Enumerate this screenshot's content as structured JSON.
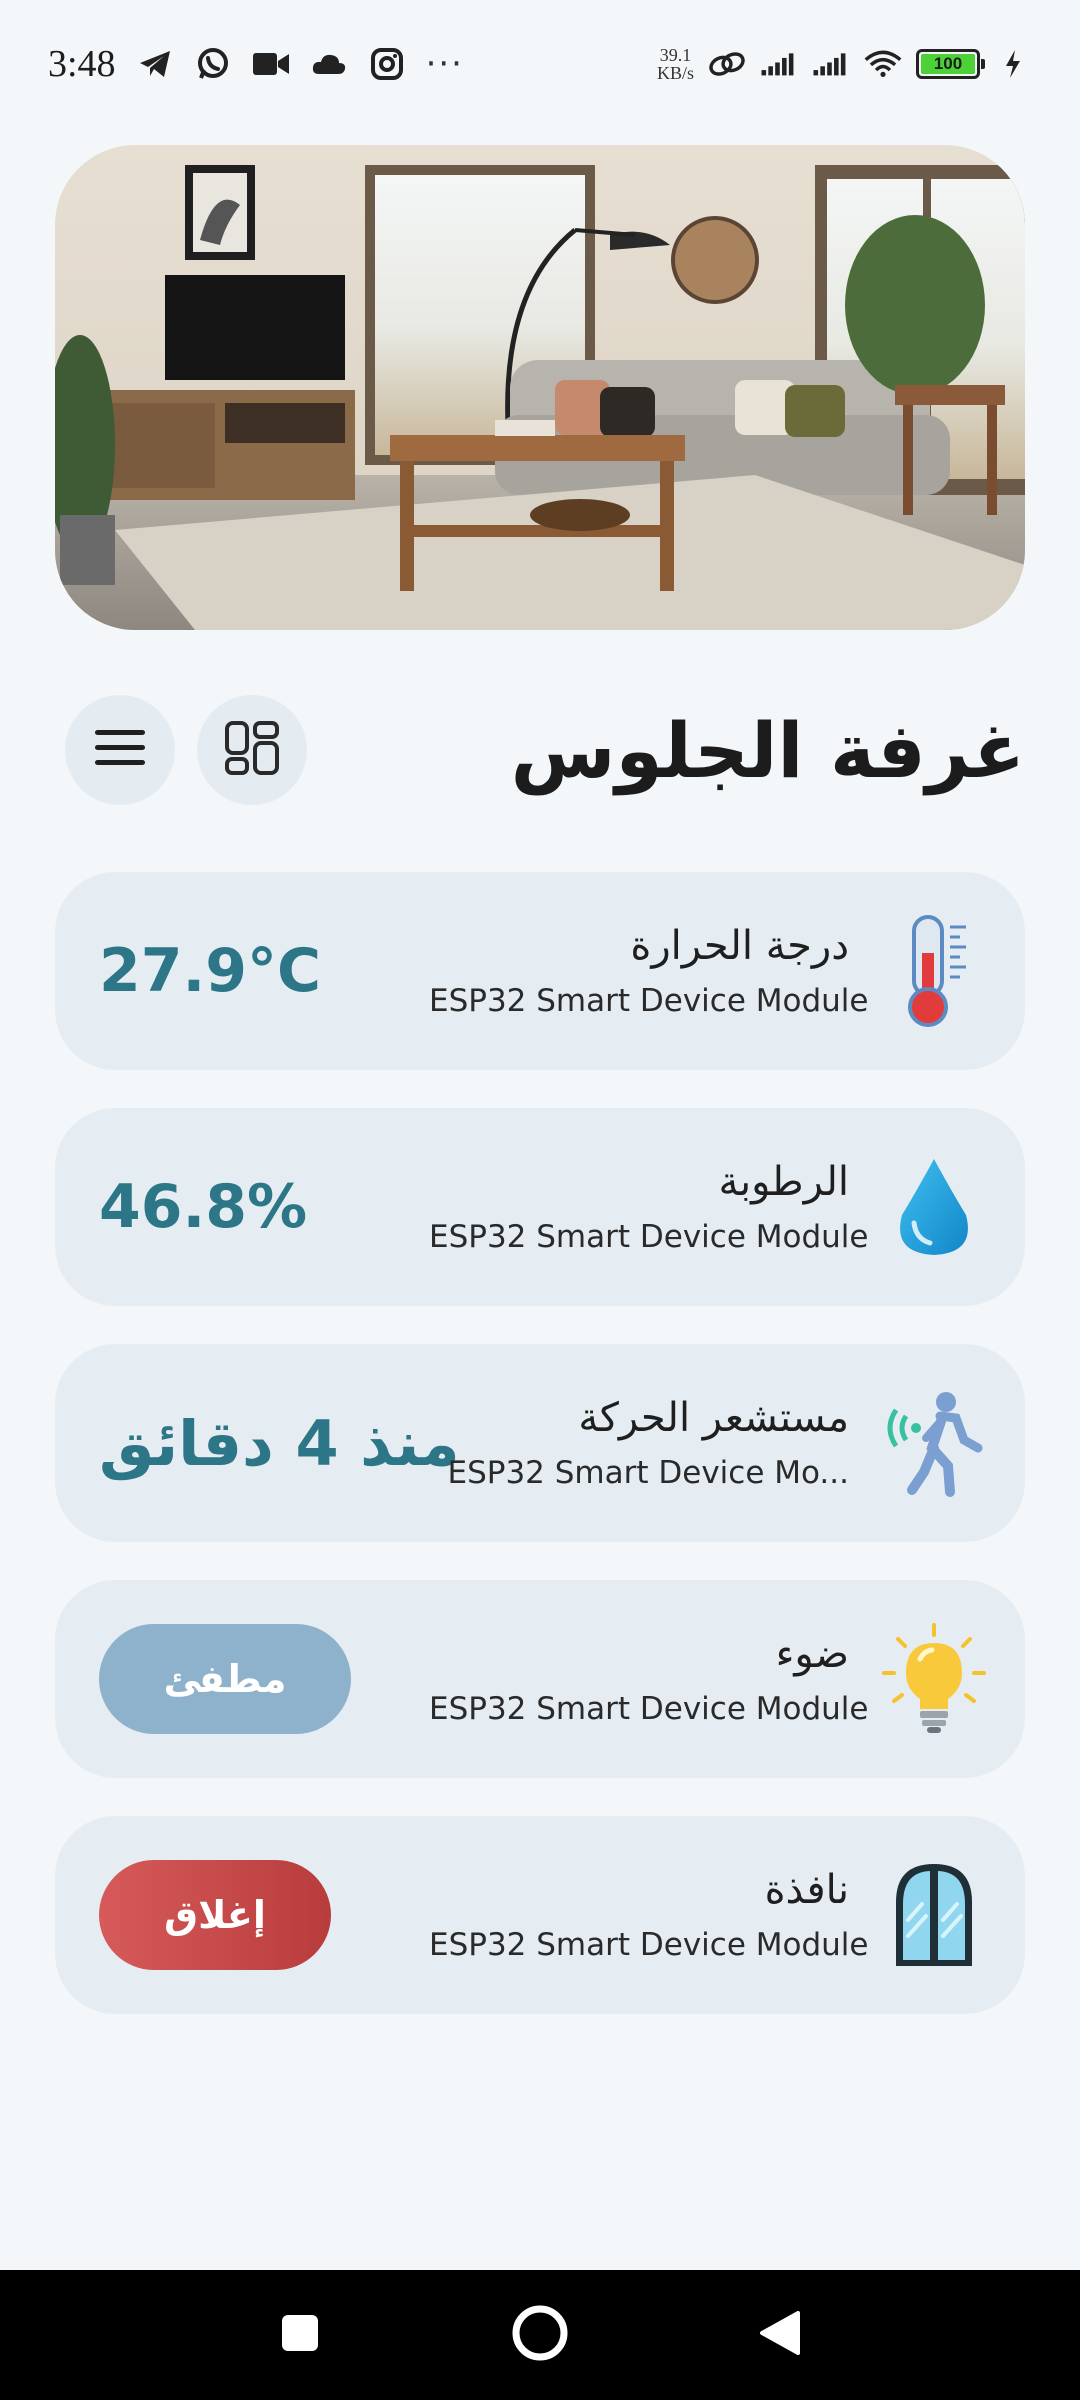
{
  "status_bar": {
    "time": "3:48",
    "icons": [
      "telegram-icon",
      "whatsapp-icon",
      "video-icon",
      "cloud-icon",
      "instagram-icon"
    ],
    "more": "···",
    "net_speed_value": "39.1",
    "net_speed_unit": "KB/s",
    "battery_level": "100"
  },
  "hero": {
    "image_alt": "living room"
  },
  "header": {
    "title": "غرفة الجلوس",
    "grid_button_icon": "grid-icon",
    "menu_button_icon": "hamburger-menu-icon"
  },
  "devices": [
    {
      "name": "درجة الحرارة",
      "subtitle": "ESP32 Smart Device Module",
      "value": "27.9°C",
      "icon": "thermometer-icon"
    },
    {
      "name": "الرطوبة",
      "subtitle": "ESP32 Smart Device Module",
      "value": "46.8%",
      "icon": "water-drop-icon"
    },
    {
      "name": "مستشعر الحركة",
      "subtitle": "ESP32 Smart Device Mo...",
      "value": "منذ 4 دقائق",
      "icon": "motion-sensor-icon"
    },
    {
      "name": "ضوء",
      "subtitle": "ESP32 Smart Device Module",
      "button": "مطفئ",
      "icon": "light-bulb-icon"
    },
    {
      "name": "نافذة",
      "subtitle": "ESP32 Smart Device Module",
      "button": "إغلاق",
      "icon": "window-icon"
    }
  ],
  "colors": {
    "background": "#f3f7fa",
    "card": "#e6edf2",
    "value_text": "#2c7687",
    "off_button": "#8fb2cc",
    "close_button": "#c94a4a"
  }
}
